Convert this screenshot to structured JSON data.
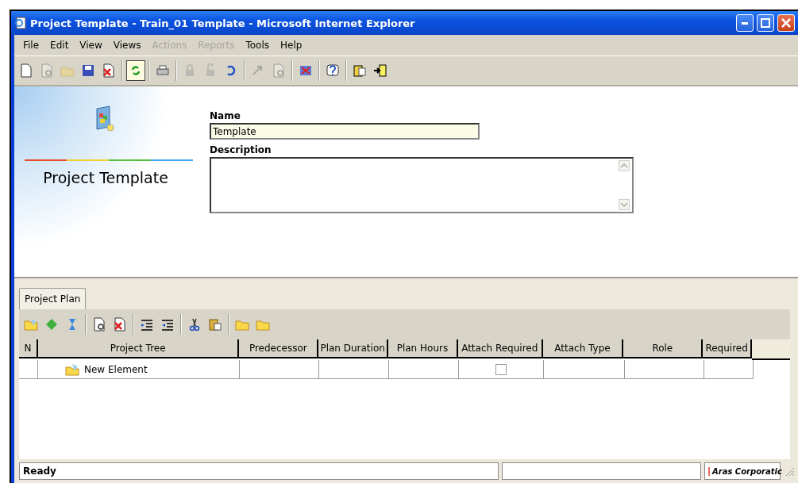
{
  "window": {
    "title": "Project Template - Train_01 Template - Microsoft Internet Explorer"
  },
  "menu": [
    {
      "label": "File",
      "disabled": false
    },
    {
      "label": "Edit",
      "disabled": false
    },
    {
      "label": "View",
      "disabled": false
    },
    {
      "label": "Views",
      "disabled": false
    },
    {
      "label": "Actions",
      "disabled": true
    },
    {
      "label": "Reports",
      "disabled": true
    },
    {
      "label": "Tools",
      "disabled": false
    },
    {
      "label": "Help",
      "disabled": false
    }
  ],
  "toolbar": [
    {
      "kind": "new",
      "disabled": false
    },
    {
      "kind": "view",
      "disabled": true
    },
    {
      "kind": "open",
      "disabled": true
    },
    {
      "kind": "save",
      "disabled": false
    },
    {
      "kind": "delete",
      "disabled": false
    },
    {
      "kind": "separator"
    },
    {
      "kind": "refresh",
      "disabled": false
    },
    {
      "kind": "separator"
    },
    {
      "kind": "print",
      "disabled": false
    },
    {
      "kind": "separator"
    },
    {
      "kind": "lock",
      "disabled": true
    },
    {
      "kind": "unlock",
      "disabled": true
    },
    {
      "kind": "undo",
      "disabled": false
    },
    {
      "kind": "separator"
    },
    {
      "kind": "promote",
      "disabled": true
    },
    {
      "kind": "view",
      "disabled": true
    },
    {
      "kind": "separator"
    },
    {
      "kind": "export",
      "disabled": false
    },
    {
      "kind": "separator"
    },
    {
      "kind": "help",
      "disabled": false
    },
    {
      "kind": "separator"
    },
    {
      "kind": "properties",
      "disabled": false
    },
    {
      "kind": "exit",
      "disabled": false
    }
  ],
  "banner": {
    "title": "Project Template"
  },
  "form": {
    "fields": [
      {
        "label": "Name",
        "value": "Template"
      },
      {
        "label": "Description"
      }
    ]
  },
  "tabs": [
    {
      "label": "Project Plan",
      "selected": true
    }
  ],
  "grid_toolbar": [
    {
      "kind": "folder-new"
    },
    {
      "kind": "diamond"
    },
    {
      "kind": "hourglass"
    },
    {
      "kind": "separator"
    },
    {
      "kind": "view"
    },
    {
      "kind": "delete"
    },
    {
      "kind": "separator"
    },
    {
      "kind": "indent"
    },
    {
      "kind": "outdent"
    },
    {
      "kind": "separator"
    },
    {
      "kind": "cut"
    },
    {
      "kind": "paste"
    },
    {
      "kind": "separator"
    },
    {
      "kind": "folder"
    },
    {
      "kind": "folder"
    }
  ],
  "table": {
    "columns": [
      "N",
      "Project Tree",
      "Predecessor",
      "Plan Duration",
      "Plan Hours",
      "Attach Required",
      "Attach Type",
      "Role",
      "Required"
    ],
    "rows": [
      {
        "name": "New Element",
        "attach_required": false
      }
    ]
  },
  "status_bar": {
    "message": "Ready",
    "company": "Aras Corporatic"
  }
}
